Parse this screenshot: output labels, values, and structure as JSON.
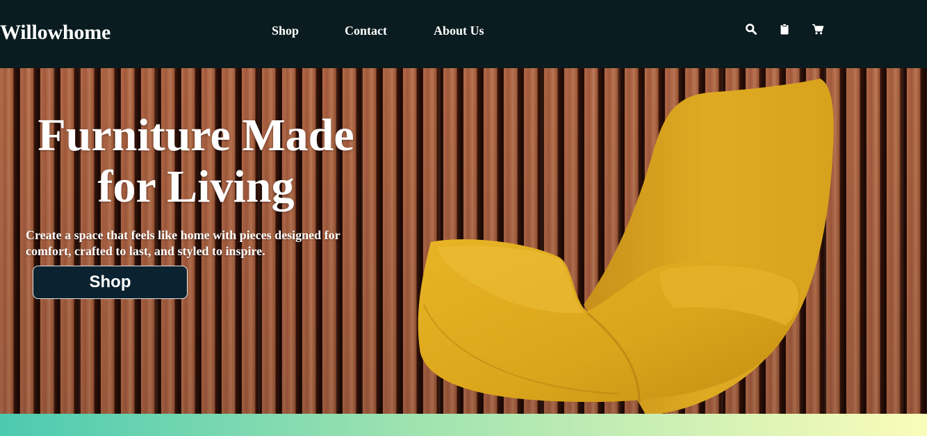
{
  "header": {
    "brand": "Willowhome",
    "nav": [
      {
        "label": "Shop"
      },
      {
        "label": "Contact"
      },
      {
        "label": "About Us"
      }
    ],
    "icons": [
      "search-icon",
      "clipboard-icon",
      "cart-icon"
    ]
  },
  "hero": {
    "title_line1": "Furniture Made",
    "title_line2": "for Living",
    "subtitle": "Create a space that feels like home with pieces designed for comfort, crafted to last, and styled to inspire.",
    "button_label": "Shop",
    "image": "yellow-lounge-chair"
  },
  "colors": {
    "nav_bg": "#0a1c20",
    "button_bg": "#0b2330",
    "chair": "#e0ad20",
    "gradient_start": "#4ccab0",
    "gradient_end": "#fbfcb9"
  }
}
